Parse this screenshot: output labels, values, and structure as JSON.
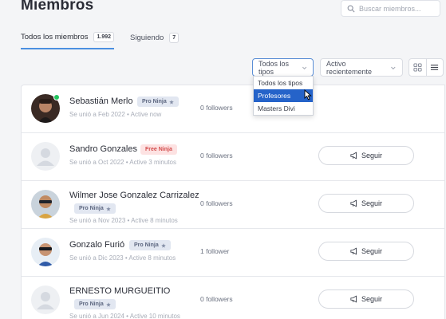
{
  "page": {
    "title": "Miembros"
  },
  "search": {
    "placeholder": "Buscar miembros..."
  },
  "tabs": [
    {
      "label": "Todos los miembros",
      "count": "1.992",
      "active": true
    },
    {
      "label": "Siguiendo",
      "count": "7",
      "active": false
    }
  ],
  "filters": {
    "type_selected": "Todos los tipos",
    "type_options": [
      "Todos los tipos",
      "Profesores",
      "Masters Divi"
    ],
    "type_highlighted": "Profesores",
    "activity_selected": "Activo recientemente"
  },
  "follow_label": "Seguir",
  "members": [
    {
      "name": "Sebastián Merlo",
      "badge": "Pro Ninja",
      "badge_type": "pro",
      "meta": "Se unió a Feb 2022 • Active now",
      "followers": "0 followers",
      "online": true
    },
    {
      "name": "Sandro Gonzales",
      "badge": "Free Ninja",
      "badge_type": "free",
      "meta": "Se unió a Oct 2022 • Active 3 minutos",
      "followers": "0 followers",
      "online": false
    },
    {
      "name": "Wilmer Jose Gonzalez Carrizalez",
      "badge": "Pro Ninja",
      "badge_type": "pro",
      "meta": "Se unió a Nov 2023 • Active 8 minutos",
      "followers": "0 followers",
      "online": false
    },
    {
      "name": "Gonzalo Furió",
      "badge": "Pro Ninja",
      "badge_type": "pro",
      "meta": "Se unió a Dic 2023 • Active 8 minutos",
      "followers": "1 follower",
      "online": false
    },
    {
      "name": "ERNESTO MURGUEITIO",
      "badge": "Pro Ninja",
      "badge_type": "pro",
      "meta": "Se unió a Jun 2024 • Active 10 minutos",
      "followers": "0 followers",
      "online": false
    }
  ],
  "colors": {
    "accent": "#4a8fe0",
    "selected_option": "#2563c9",
    "online": "#22c55e",
    "free_badge": "#fde2e2",
    "pro_badge": "#e2e7f1"
  }
}
